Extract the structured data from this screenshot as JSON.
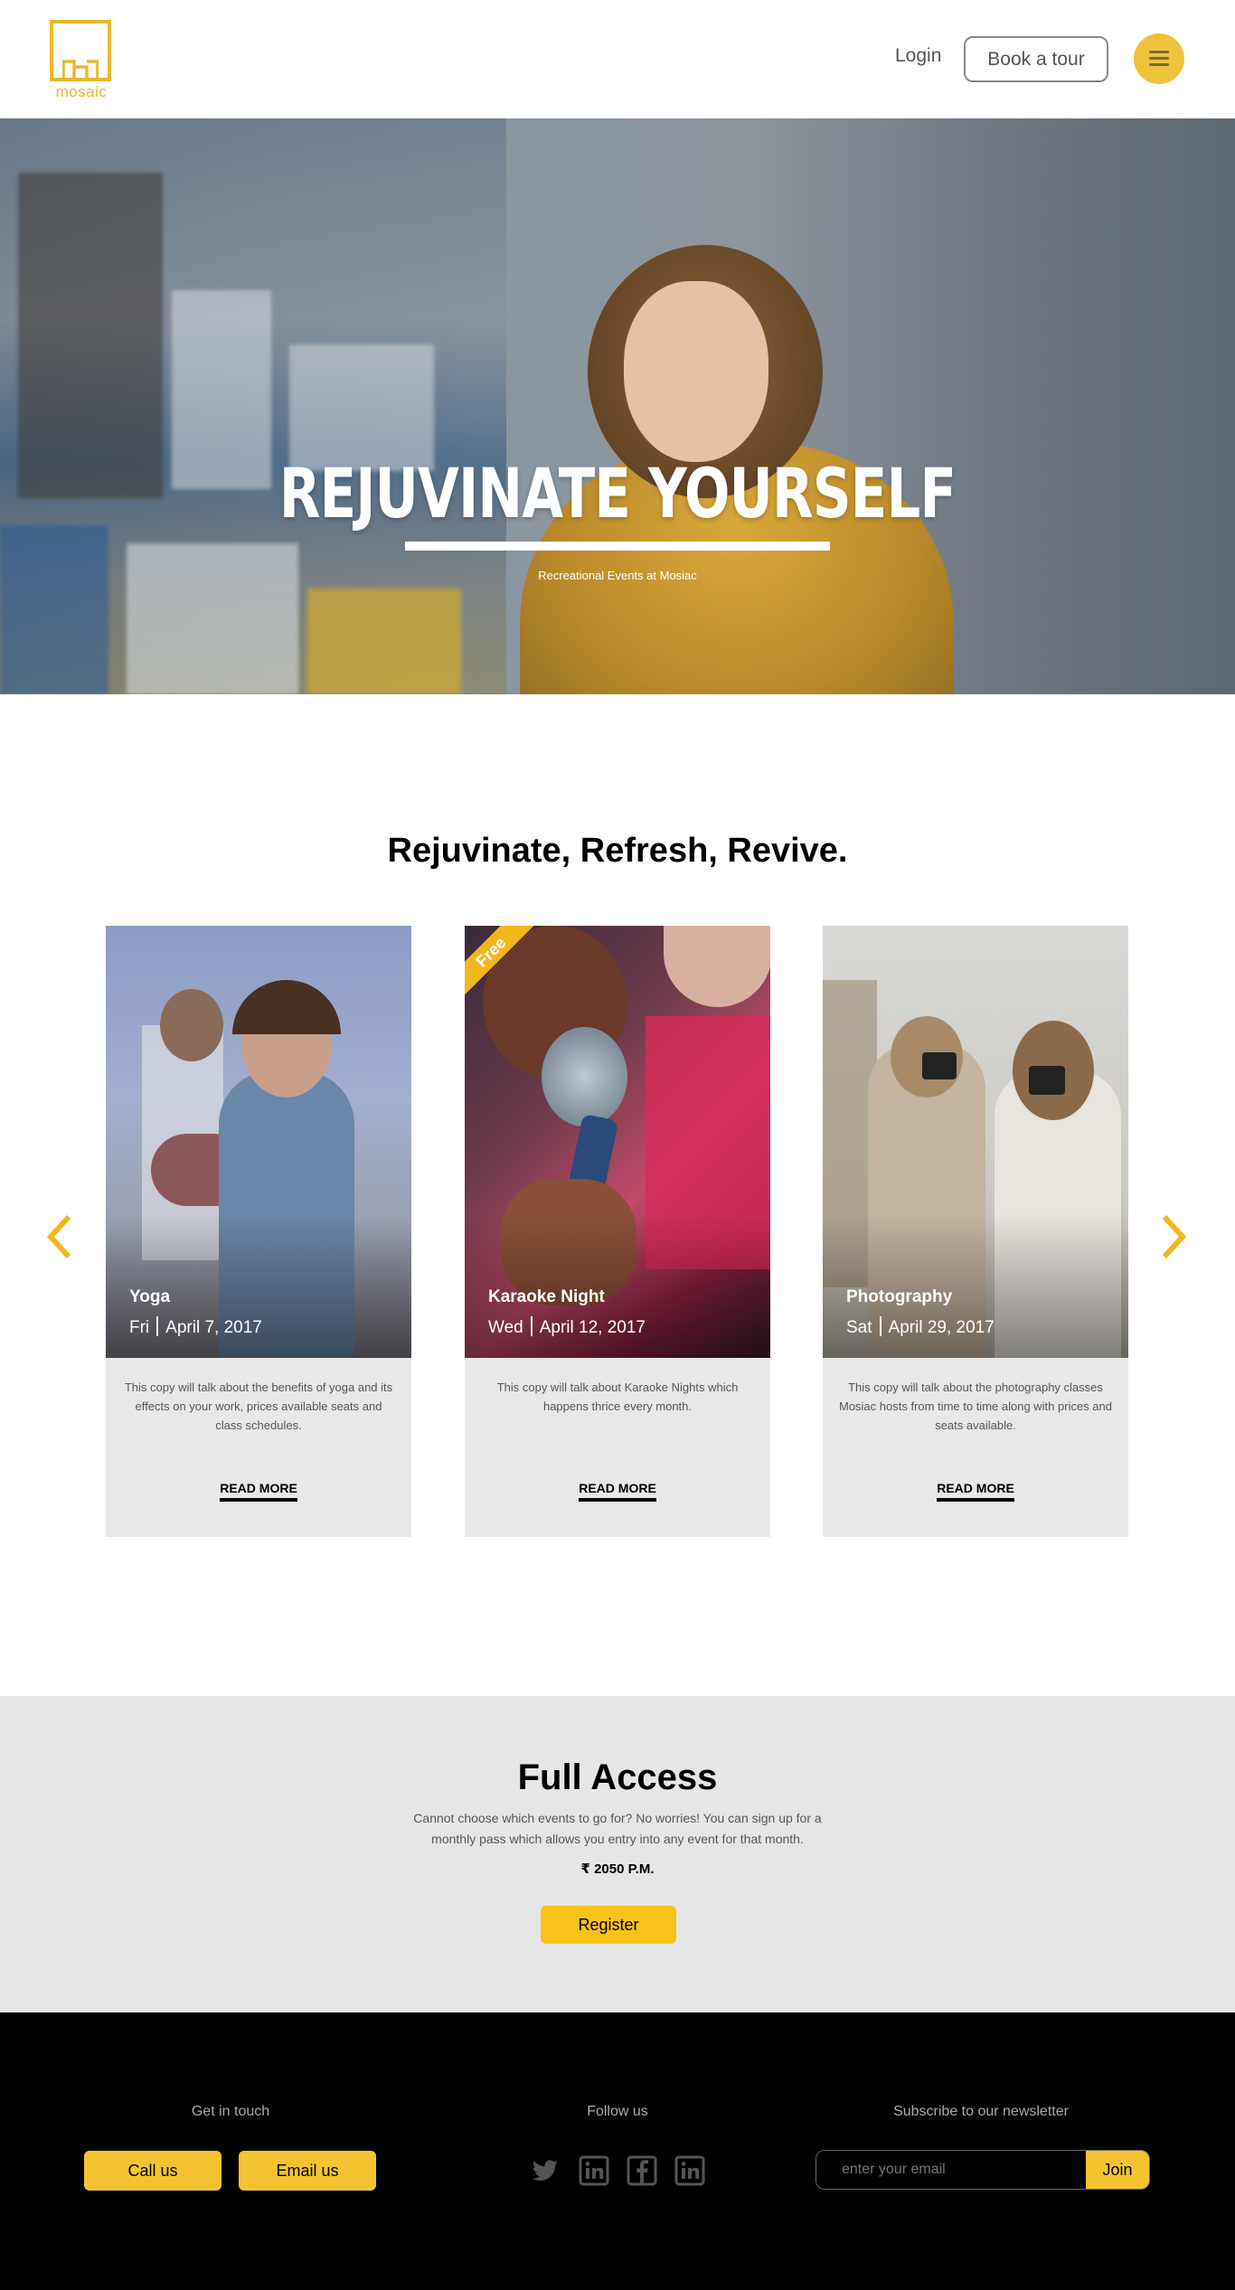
{
  "header": {
    "logo_text": "mosaic",
    "login_label": "Login",
    "book_label": "Book a tour"
  },
  "hero": {
    "title": "REJUVINATE YOURSELF",
    "subtitle": "Recreational Events at Mosiac"
  },
  "events": {
    "heading": "Rejuvinate, Refresh, Revive.",
    "cards": [
      {
        "name": "Yoga",
        "day": "Fri",
        "date": "April 7, 2017",
        "description": "This copy will talk about the benefits of yoga and its effects on your work, prices available seats and class schedules.",
        "read_more": "READ MORE"
      },
      {
        "name": "Karaoke Night",
        "day": "Wed",
        "date": "April 12, 2017",
        "badge": "Free",
        "description": "This copy will talk about Karaoke Nights which happens thrice every month.",
        "read_more": "READ MORE"
      },
      {
        "name": "Photography",
        "day": "Sat",
        "date": "April 29, 2017",
        "description": "This copy will talk about the photography classes Mosiac hosts from time to time along with prices and seats available.",
        "read_more": "READ MORE"
      }
    ]
  },
  "access": {
    "heading": "Full Access",
    "description": "Cannot choose which events to go for? No worries! You can sign up for a monthly pass which allows you entry into any event for that month.",
    "price": "₹ 2050 P.M.",
    "register_label": "Register"
  },
  "footer": {
    "contact_heading": "Get in touch",
    "call_label": "Call us",
    "email_label": "Email us",
    "follow_heading": "Follow us",
    "newsletter_heading": "Subscribe to our newsletter",
    "email_placeholder": "enter your email",
    "join_label": "Join"
  },
  "colors": {
    "accent": "#f4c430",
    "logo": "#e9b82d",
    "footer_bg": "#000000",
    "access_bg": "#e6e6e6"
  }
}
